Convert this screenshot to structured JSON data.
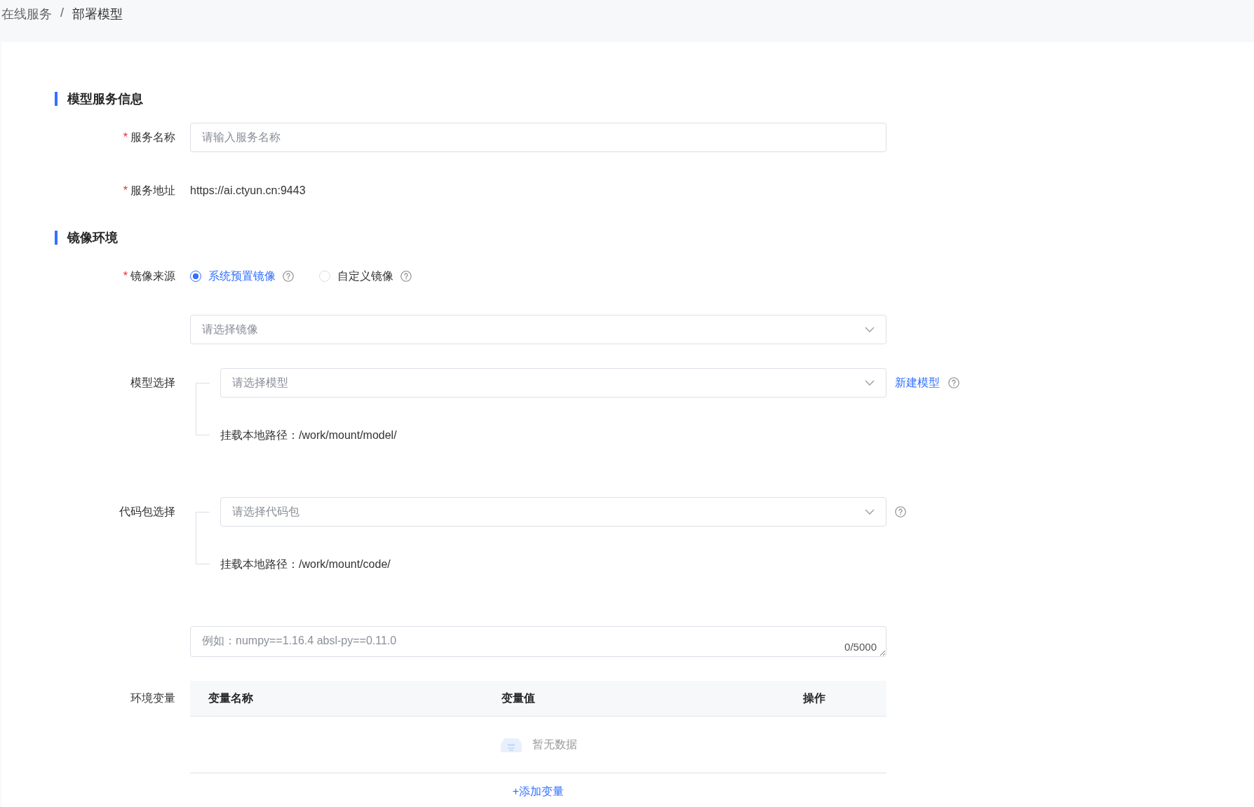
{
  "breadcrumb": {
    "separator": "/",
    "items": [
      {
        "label": "在线服务",
        "current": false
      },
      {
        "label": "部署模型",
        "current": true
      }
    ]
  },
  "sections": [
    {
      "title": "模型服务信息",
      "fields": [
        {
          "kind": "input",
          "required_mark": "*",
          "label": "服务名称",
          "placeholder": "请输入服务名称"
        },
        {
          "kind": "text",
          "required_mark": "*",
          "label": "服务地址",
          "value": "https://ai.ctyun.cn:9443"
        }
      ]
    },
    {
      "title": "镜像环境",
      "fields": [
        {
          "kind": "radio",
          "required_mark": "*",
          "label": "镜像来源",
          "options": [
            {
              "label": "系统预置镜像",
              "selected": true,
              "help": true
            },
            {
              "label": "自定义镜像",
              "selected": false,
              "help": true
            }
          ]
        },
        {
          "kind": "select",
          "placeholder": "请选择镜像"
        },
        {
          "kind": "mount-select",
          "label": "模型选择",
          "placeholder": "请选择模型",
          "link": "新建模型",
          "help": true,
          "mount_text": "挂载本地路径：/work/mount/model/"
        },
        {
          "kind": "mount-select",
          "label": "代码包选择",
          "placeholder": "请选择代码包",
          "help": true,
          "mount_text": "挂载本地路径：/work/mount/code/"
        },
        {
          "kind": "textarea",
          "placeholder": "例如：numpy==1.16.4 absl-py==0.11.0",
          "counter": "0/5000"
        },
        {
          "kind": "table",
          "label": "环境变量",
          "columns": [
            "变量名称",
            "变量值",
            "操作"
          ],
          "empty_text": "暂无数据",
          "add_link": "+添加变量"
        }
      ]
    }
  ]
}
